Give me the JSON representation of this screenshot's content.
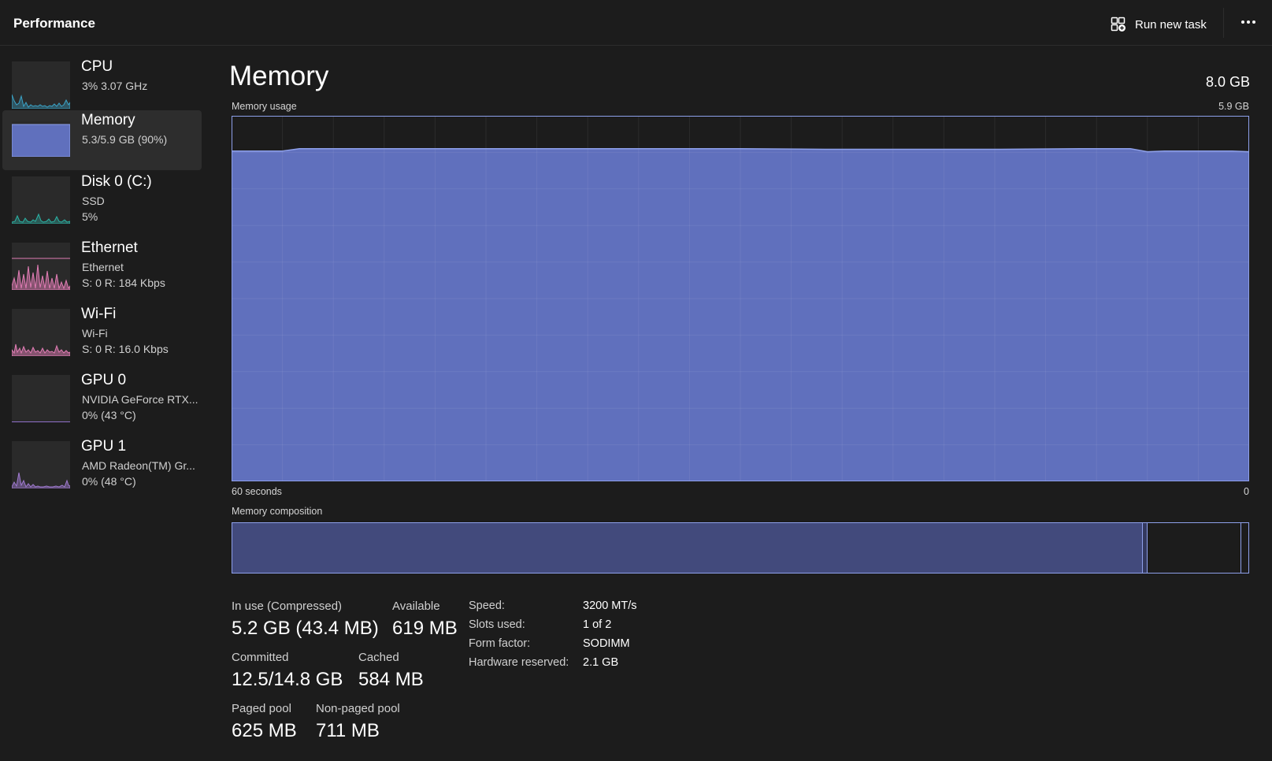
{
  "header": {
    "title": "Performance",
    "run_new_task_label": "Run new task",
    "more_icon": "more-horizontal-icon",
    "run_task_icon": "run-task-icon"
  },
  "sidebar": {
    "items": [
      {
        "name": "CPU",
        "line1": "3%  3.07 GHz",
        "line2": "",
        "color": "#3aa4c8"
      },
      {
        "name": "Memory",
        "line1": "5.3/5.9 GB (90%)",
        "line2": "",
        "color": "#8ea0ea",
        "active": true
      },
      {
        "name": "Disk 0 (C:)",
        "line1": "SSD",
        "line2": "5%",
        "color": "#2bb3a5"
      },
      {
        "name": "Ethernet",
        "line1": "Ethernet",
        "line2": "S: 0  R: 184 Kbps",
        "color": "#e07cb4"
      },
      {
        "name": "Wi-Fi",
        "line1": "Wi-Fi",
        "line2": "S: 0  R: 16.0 Kbps",
        "color": "#e07cb4"
      },
      {
        "name": "GPU 0",
        "line1": "NVIDIA GeForce RTX...",
        "line2": "0%  (43 °C)",
        "color": "#8f6fc9"
      },
      {
        "name": "GPU 1",
        "line1": "AMD Radeon(TM) Gr...",
        "line2": "0%  (48 °C)",
        "color": "#a07ad1"
      }
    ]
  },
  "main": {
    "title": "Memory",
    "total": "8.0 GB",
    "usage_label": "Memory usage",
    "usage_max": "5.9 GB",
    "time_label": "60 seconds",
    "time_end": "0",
    "composition_label": "Memory composition"
  },
  "stats": {
    "in_use_label": "In use (Compressed)",
    "in_use_value": "5.2 GB (43.4 MB)",
    "available_label": "Available",
    "available_value": "619 MB",
    "committed_label": "Committed",
    "committed_value": "12.5/14.8 GB",
    "cached_label": "Cached",
    "cached_value": "584 MB",
    "paged_label": "Paged pool",
    "paged_value": "625 MB",
    "nonpaged_label": "Non-paged pool",
    "nonpaged_value": "711 MB"
  },
  "specs": {
    "speed_key": "Speed:",
    "speed_val": "3200 MT/s",
    "slots_key": "Slots used:",
    "slots_val": "1 of 2",
    "form_key": "Form factor:",
    "form_val": "SODIMM",
    "hw_key": "Hardware reserved:",
    "hw_val": "2.1 GB"
  },
  "colors": {
    "memory_fill": "#6070bd",
    "memory_line": "#8ea0ea",
    "composition_in_use": "#424a7c"
  },
  "chart_data": {
    "type": "area",
    "xlabel": "60 seconds",
    "xlim": [
      60,
      0
    ],
    "ylim": [
      0,
      5.9
    ],
    "series": [
      {
        "x": [
          60,
          59,
          58,
          57,
          56,
          55,
          54,
          53,
          52,
          51,
          50,
          45,
          40,
          35,
          30,
          25,
          20,
          15,
          10,
          8,
          7,
          6,
          5,
          4,
          3,
          2,
          1,
          0
        ],
        "values": [
          5.33,
          5.33,
          5.33,
          5.33,
          5.37,
          5.37,
          5.37,
          5.37,
          5.37,
          5.37,
          5.37,
          5.37,
          5.37,
          5.37,
          5.37,
          5.36,
          5.36,
          5.36,
          5.37,
          5.37,
          5.37,
          5.32,
          5.33,
          5.33,
          5.33,
          5.33,
          5.33,
          5.32
        ]
      }
    ]
  }
}
